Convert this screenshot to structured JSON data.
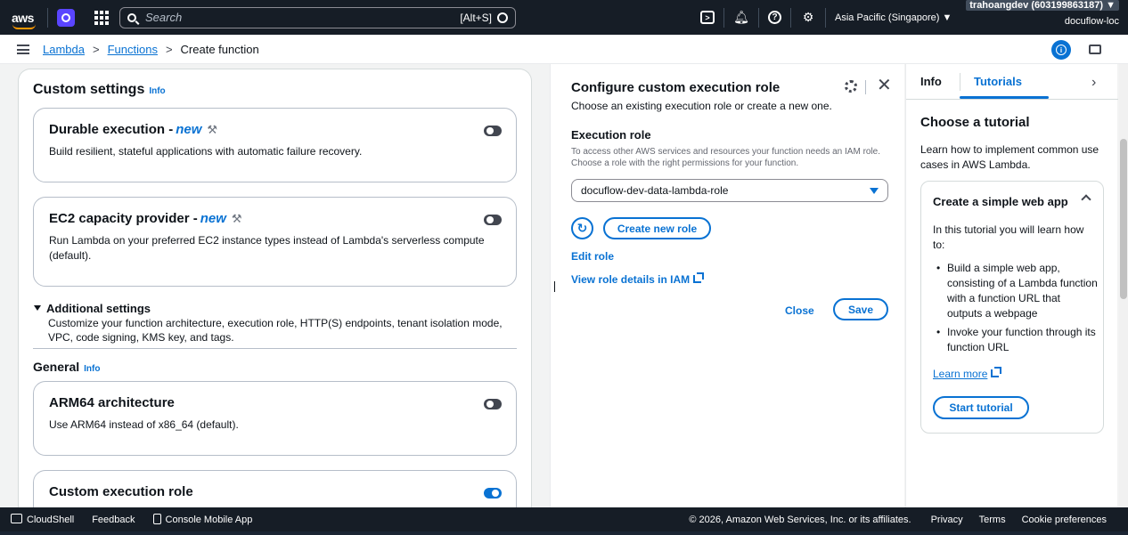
{
  "topnav": {
    "logo_text": "aws",
    "search_placeholder": "Search",
    "search_shortcut": "[Alt+S]",
    "region": "Asia Pacific (Singapore) ▼",
    "account": "trahoangdev (603199863187) ▼",
    "user": "docuflow-loc",
    "icons": [
      "cloudshell-icon",
      "bell-icon",
      "help-icon",
      "gear-icon"
    ]
  },
  "breadcrumb": {
    "items": [
      "Lambda",
      "Functions"
    ],
    "current": "Create function",
    "separator": ">"
  },
  "custom_settings": {
    "title": "Custom settings",
    "info": "Info",
    "durable": {
      "title": "Durable execution -",
      "badge": "new",
      "desc": "Build resilient, stateful applications with automatic failure recovery.",
      "enabled": false
    },
    "ec2": {
      "title": "EC2 capacity provider -",
      "badge": "new",
      "desc": "Run Lambda on your preferred EC2 instance types instead of Lambda's serverless compute (default).",
      "enabled": false
    },
    "additional": {
      "title": "Additional settings",
      "desc": "Customize your function architecture, execution role, HTTP(S) endpoints, tenant isolation mode, VPC, code signing, KMS key, and tags."
    }
  },
  "general": {
    "title": "General",
    "info": "Info",
    "arm64": {
      "title": "ARM64 architecture",
      "desc": "Use ARM64 instead of x86_64 (default).",
      "enabled": false
    },
    "custom_role": {
      "title": "Custom execution role",
      "enabled": true
    }
  },
  "config_role": {
    "title": "Configure custom execution role",
    "subtitle": "Choose an existing execution role or create a new one.",
    "field_label": "Execution role",
    "field_desc": "To access other AWS services and resources your function needs an IAM role. Choose a role with the right permissions for your function.",
    "selected_role": "docuflow-dev-data-lambda-role",
    "create_new_role": "Create new role",
    "edit_role": "Edit role",
    "view_role_details": "View role details in IAM",
    "close": "Close",
    "save": "Save"
  },
  "tutorials_panel": {
    "tabs": [
      "Info",
      "Tutorials"
    ],
    "active_tab": "Tutorials",
    "heading": "Choose a tutorial",
    "intro": "Learn how to implement common use cases in AWS Lambda.",
    "card": {
      "title": "Create a simple web app",
      "intro": "In this tutorial you will learn how to:",
      "steps": [
        "Build a simple web app, consisting of a Lambda function with a function URL that outputs a webpage",
        "Invoke your function through its function URL"
      ],
      "learn_more": "Learn more",
      "start": "Start tutorial"
    }
  },
  "footer": {
    "cloudshell": "CloudShell",
    "feedback": "Feedback",
    "mobile_app": "Console Mobile App",
    "copyright": "© 2026, Amazon Web Services, Inc. or its affiliates.",
    "privacy": "Privacy",
    "terms": "Terms",
    "cookies": "Cookie preferences"
  },
  "colors": {
    "nav_bg": "#161d26",
    "link": "#0972d3",
    "aws_orange": "#ff9900",
    "app_badge": "#5a45ff"
  }
}
